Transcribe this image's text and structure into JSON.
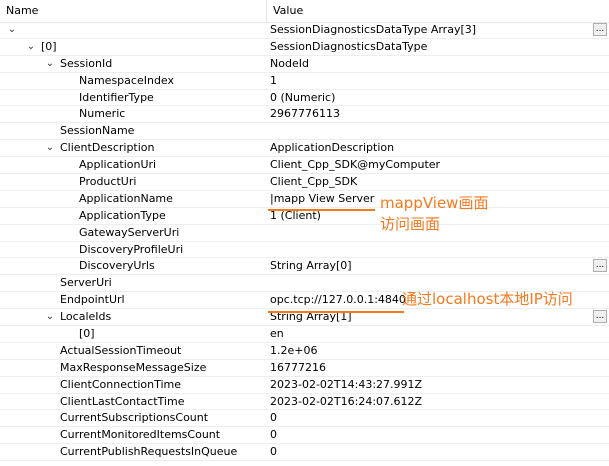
{
  "header": {
    "name_label": "Name",
    "value_label": "Value"
  },
  "rows": [
    {
      "indent": 0,
      "expander": "chevron-down",
      "name": "",
      "value": "SessionDiagnosticsDataType Array[3]",
      "button": "..."
    },
    {
      "indent": 1,
      "expander": "chevron-down",
      "name": "[0]",
      "value": "SessionDiagnosticsDataType"
    },
    {
      "indent": 2,
      "expander": "chevron-down",
      "name": "SessionId",
      "value": "NodeId"
    },
    {
      "indent": 3,
      "expander": "",
      "name": "NamespaceIndex",
      "value": "1"
    },
    {
      "indent": 3,
      "expander": "",
      "name": "IdentifierType",
      "value": "0 (Numeric)"
    },
    {
      "indent": 3,
      "expander": "",
      "name": "Numeric",
      "value": "2967776113"
    },
    {
      "indent": 2,
      "expander": "",
      "name": "SessionName",
      "value": ""
    },
    {
      "indent": 2,
      "expander": "chevron-down",
      "name": "ClientDescription",
      "value": "ApplicationDescription"
    },
    {
      "indent": 3,
      "expander": "",
      "name": "ApplicationUri",
      "value": "Client_Cpp_SDK@myComputer"
    },
    {
      "indent": 3,
      "expander": "",
      "name": "ProductUri",
      "value": "Client_Cpp_SDK"
    },
    {
      "indent": 3,
      "expander": "",
      "name": "ApplicationName",
      "value": "|mapp View Server"
    },
    {
      "indent": 3,
      "expander": "",
      "name": "ApplicationType",
      "value": "1 (Client)"
    },
    {
      "indent": 3,
      "expander": "",
      "name": "GatewayServerUri",
      "value": ""
    },
    {
      "indent": 3,
      "expander": "",
      "name": "DiscoveryProfileUri",
      "value": ""
    },
    {
      "indent": 3,
      "expander": "",
      "name": "DiscoveryUrls",
      "value": "String Array[0]",
      "button": "..."
    },
    {
      "indent": 2,
      "expander": "",
      "name": "ServerUri",
      "value": ""
    },
    {
      "indent": 2,
      "expander": "",
      "name": "EndpointUrl",
      "value": "opc.tcp://127.0.0.1:4840"
    },
    {
      "indent": 2,
      "expander": "chevron-down",
      "name": "LocaleIds",
      "value": "String Array[1]",
      "button": "..."
    },
    {
      "indent": 3,
      "expander": "",
      "name": "[0]",
      "value": "en"
    },
    {
      "indent": 2,
      "expander": "",
      "name": "ActualSessionTimeout",
      "value": "1.2e+06"
    },
    {
      "indent": 2,
      "expander": "",
      "name": "MaxResponseMessageSize",
      "value": "16777216"
    },
    {
      "indent": 2,
      "expander": "",
      "name": "ClientConnectionTime",
      "value": "2023-02-02T14:43:27.991Z"
    },
    {
      "indent": 2,
      "expander": "",
      "name": "ClientLastContactTime",
      "value": "2023-02-02T16:24:07.612Z"
    },
    {
      "indent": 2,
      "expander": "",
      "name": "CurrentSubscriptionsCount",
      "value": "0"
    },
    {
      "indent": 2,
      "expander": "",
      "name": "CurrentMonitoredItemsCount",
      "value": "0"
    },
    {
      "indent": 2,
      "expander": "",
      "name": "CurrentPublishRequestsInQueue",
      "value": "0"
    }
  ],
  "annotations": {
    "mappview_line1": "mappView画面",
    "mappview_line2": "访问画面",
    "localhost": "通过localhost本地IP访问",
    "color": "#f47a1f"
  }
}
